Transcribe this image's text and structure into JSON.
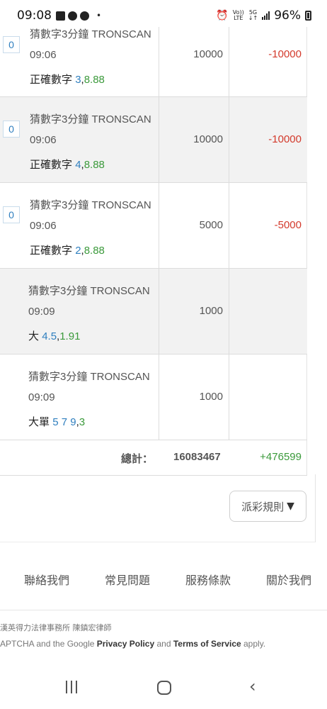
{
  "status_bar": {
    "time": "09:08",
    "dot": "•",
    "net_top": "Vo))",
    "net_bottom": "LTE",
    "gen_top": "5G",
    "gen_bottom": "↓↑",
    "battery": "96%"
  },
  "rows": [
    {
      "badge": "0",
      "game": "猜數字3分鐘 TRONSCAN",
      "time": "09:06",
      "bet_prefix": "正確數字",
      "bet_num": "3",
      "odds": "8.88",
      "amount": "10000",
      "win": "-10000"
    },
    {
      "badge": "0",
      "game": "猜數字3分鐘 TRONSCAN",
      "time": "09:06",
      "bet_prefix": "正確數字",
      "bet_num": "4",
      "odds": "8.88",
      "amount": "10000",
      "win": "-10000"
    },
    {
      "badge": "0",
      "game": "猜數字3分鐘 TRONSCAN",
      "time": "09:06",
      "bet_prefix": "正確數字",
      "bet_num": "2",
      "odds": "8.88",
      "amount": "5000",
      "win": "-5000"
    },
    {
      "badge": "",
      "game": "猜數字3分鐘 TRONSCAN",
      "time": "09:09",
      "bet_prefix": "大",
      "bet_num": "4.5",
      "odds": "1.91",
      "amount": "1000",
      "win": ""
    },
    {
      "badge": "",
      "game": "猜數字3分鐘 TRONSCAN",
      "time": "09:09",
      "bet_prefix": "大單",
      "bet_num": "5 7 9",
      "odds": "3",
      "amount": "1000",
      "win": ""
    }
  ],
  "total": {
    "label": "總計：",
    "amount": "16083467",
    "win": "+476599"
  },
  "rules_button": {
    "label": "派彩規則",
    "arrow": "▼"
  },
  "footer": {
    "links": [
      "聯絡我們",
      "常見問題",
      "服務條款",
      "關於我們"
    ],
    "legal_line1": "漢英得力法律事務所 陳鎮宏律師",
    "legal_line2_prefix": "APTCHA and the Google ",
    "privacy": "Privacy Policy",
    "legal_and": " and ",
    "terms": "Terms of Service",
    "legal_suffix": " apply."
  }
}
